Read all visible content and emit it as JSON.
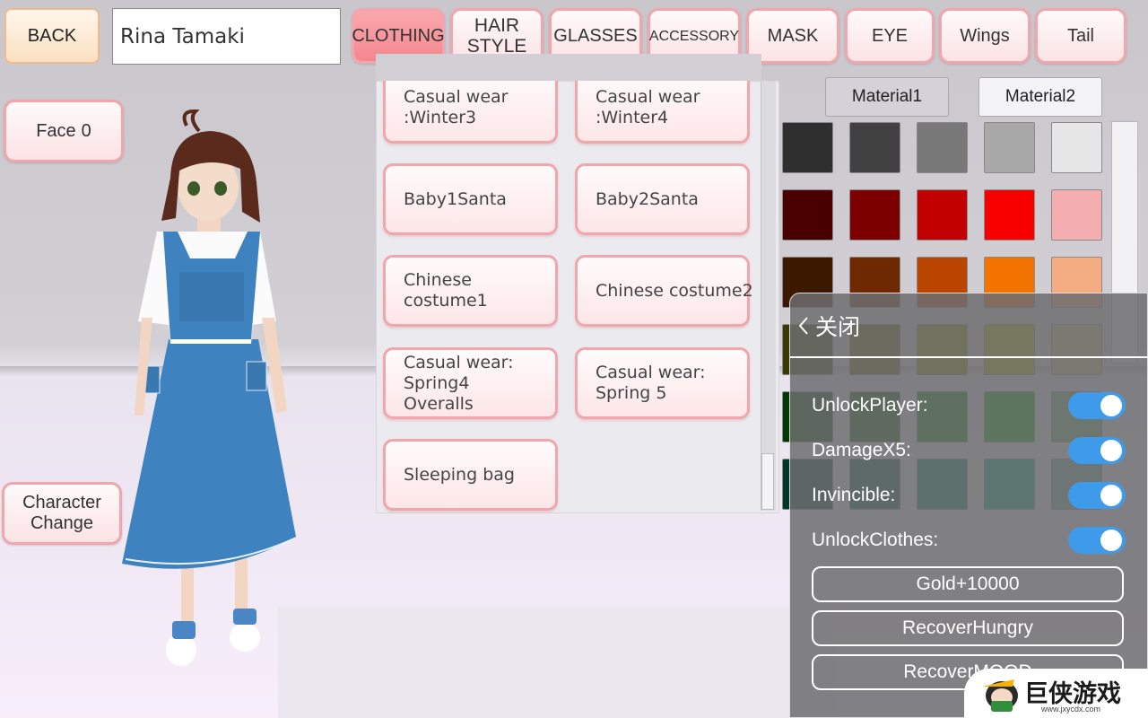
{
  "header": {
    "back_label": "BACK",
    "name_value": "Rina Tamaki",
    "tabs": [
      {
        "label": "CLOTHING",
        "active": true
      },
      {
        "label": "HAIR STYLE",
        "active": false
      },
      {
        "label": "GLASSES",
        "active": false
      },
      {
        "label": "ACCESSORY",
        "active": false
      },
      {
        "label": "MASK",
        "active": false
      },
      {
        "label": "EYE",
        "active": false
      },
      {
        "label": "Wings",
        "active": false
      },
      {
        "label": "Tail",
        "active": false
      }
    ]
  },
  "left": {
    "face_label": "Face",
    "face_value": "0",
    "character_change_label": "Character Change"
  },
  "clothing_list": [
    "Casual wear :Winter3",
    "Casual wear :Winter4",
    "Baby1Santa",
    "Baby2Santa",
    "Chinese costume1",
    "Chinese costume2",
    "Casual wear: Spring4 Overalls",
    "Casual wear: Spring 5",
    "Sleeping bag"
  ],
  "materials": {
    "tabs": [
      "Material1",
      "Material2"
    ],
    "selected_tab": "Material1",
    "swatches": [
      [
        "#2f2f2f",
        "#414141",
        "#787878",
        "#a8a8a8",
        "#e6e6e6"
      ],
      [
        "#4a0000",
        "#7d0000",
        "#c20000",
        "#f80000",
        "#f4aeb0"
      ],
      [
        "#3d1800",
        "#6e2900",
        "#b94500",
        "#f47400",
        "#f4ac82"
      ],
      [
        "#3a3a00",
        "#5b5b00",
        "#888800",
        "#b6b600",
        "#c8c882"
      ],
      [
        "#003800",
        "#005800",
        "#008000",
        "#00a800",
        "#6ea86e"
      ],
      [
        "#003828",
        "#005840",
        "#008060",
        "#00a880",
        "#6ea892"
      ]
    ]
  },
  "cheat_menu": {
    "close_label": "关闭",
    "toggles": [
      {
        "label": "UnlockPlayer:",
        "on": true
      },
      {
        "label": "DamageX5:",
        "on": true
      },
      {
        "label": "Invincible:",
        "on": true
      },
      {
        "label": "UnlockClothes:",
        "on": true
      }
    ],
    "buttons": [
      "Gold+10000",
      "RecoverHungry",
      "RecoverMOOD"
    ],
    "accent_color": "#3d9be9"
  },
  "watermark": {
    "text": "巨侠游戏",
    "url": "www.jxycdx.com"
  }
}
